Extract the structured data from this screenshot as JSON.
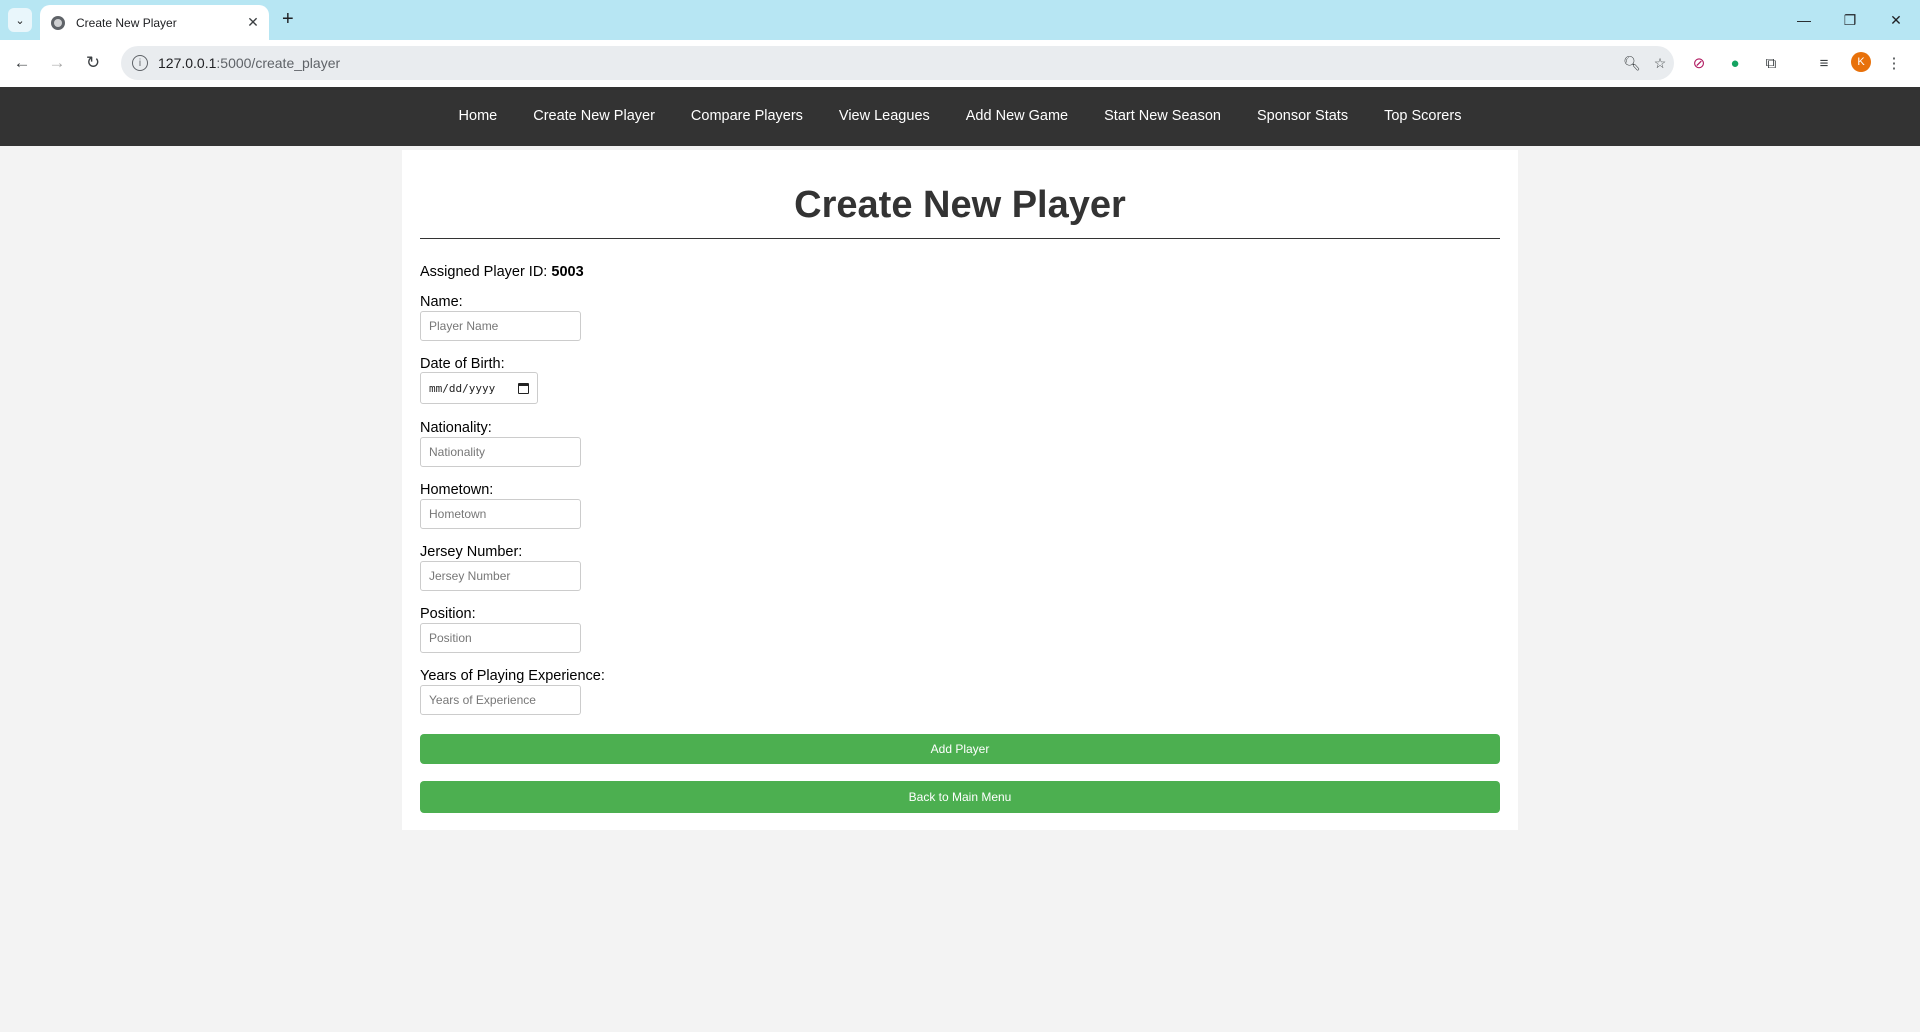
{
  "browser": {
    "tab_title": "Create New Player",
    "tab_close": "✕",
    "new_tab": "+",
    "url_host": "127.0.0.1",
    "url_path": ":5000/create_player",
    "profile_initial": "K"
  },
  "nav": {
    "items": [
      {
        "label": "Home"
      },
      {
        "label": "Create New Player"
      },
      {
        "label": "Compare Players"
      },
      {
        "label": "View Leagues"
      },
      {
        "label": "Add New Game"
      },
      {
        "label": "Start New Season"
      },
      {
        "label": "Sponsor Stats"
      },
      {
        "label": "Top Scorers"
      }
    ]
  },
  "form": {
    "title": "Create New Player",
    "assigned_label": "Assigned Player ID:",
    "assigned_id": "5003",
    "name_label": "Name:",
    "name_placeholder": "Player Name",
    "dob_label": "Date of Birth:",
    "dob_placeholder": "mm/dd/yyyy",
    "nationality_label": "Nationality:",
    "nationality_placeholder": "Nationality",
    "hometown_label": "Hometown:",
    "hometown_placeholder": "Hometown",
    "jersey_label": "Jersey Number:",
    "jersey_placeholder": "Jersey Number",
    "position_label": "Position:",
    "position_placeholder": "Position",
    "experience_label": "Years of Playing Experience:",
    "experience_placeholder": "Years of Experience",
    "add_button": "Add Player",
    "back_button": "Back to Main Menu"
  },
  "colors": {
    "navbar": "#333333",
    "button": "#4caf50",
    "page_bg": "#f3f3f3",
    "tabbar": "#b7e6f3"
  }
}
